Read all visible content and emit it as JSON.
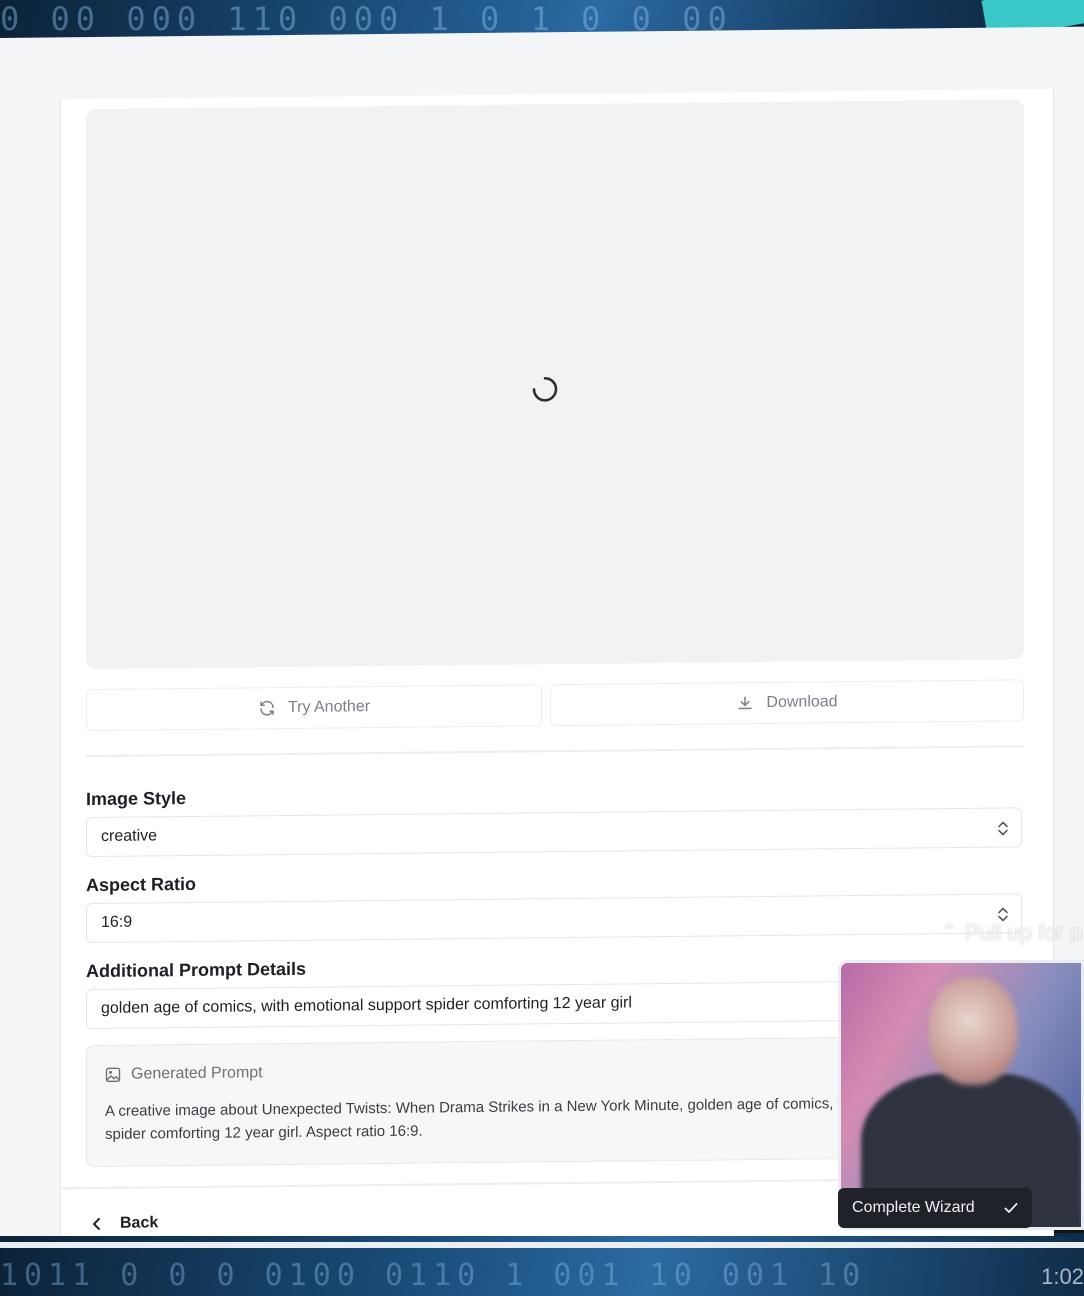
{
  "background": {
    "top_digits": "0 00  000  110 000 1   0 1 0 0 00",
    "bottom_digits": "1011 0 0  0 0100 0110 1  001 10  001 10",
    "timestamp": "1:02"
  },
  "preview": {
    "state": "loading"
  },
  "actions": {
    "try_another_label": "Try Another",
    "download_label": "Download"
  },
  "form": {
    "image_style": {
      "label": "Image Style",
      "value": "creative"
    },
    "aspect_ratio": {
      "label": "Aspect Ratio",
      "value": "16:9"
    },
    "additional_prompt": {
      "label": "Additional Prompt Details",
      "value": "golden age of comics, with emotional support spider comforting 12 year girl"
    }
  },
  "generated_prompt": {
    "title": "Generated Prompt",
    "text": "A creative image about Unexpected Twists: When Drama Strikes in a New York Minute, golden age of comics, with emotional support spider comforting 12 year girl. Aspect ratio 16:9."
  },
  "footer": {
    "back_label": "Back",
    "complete_label": "Complete Wizard"
  },
  "overlay": {
    "pull_up_text": "Pull up for p"
  },
  "colors": {
    "accent_dark": "#1f2228",
    "preview_bg": "#f2f2f3",
    "text_primary": "#1c1f24",
    "text_muted": "#7b7f86"
  }
}
